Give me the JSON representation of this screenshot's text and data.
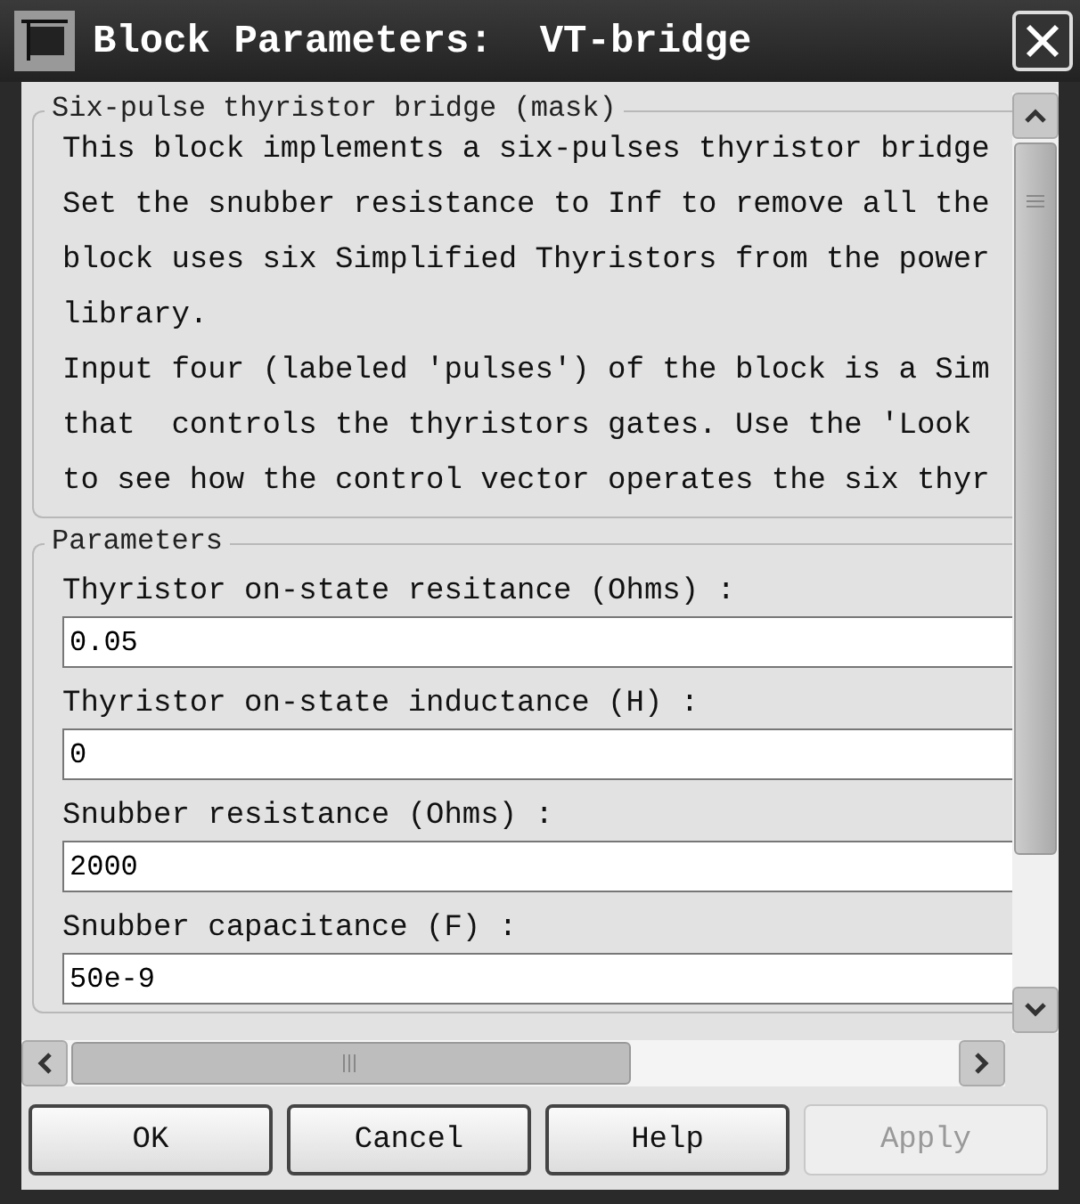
{
  "window": {
    "title": "Block Parameters:  VT-bridge"
  },
  "description": {
    "title": "Six-pulse thyristor bridge (mask)",
    "lines": [
      "This block implements a six-pulses thyristor bridge",
      "Set the snubber resistance to Inf to remove all the",
      "block uses six Simplified Thyristors from the power",
      "library.",
      "Input four (labeled 'pulses') of the block is a Sim",
      "that  controls the thyristors gates. Use the 'Look",
      "to see how the control vector operates the six thyr"
    ]
  },
  "parameters": {
    "title": "Parameters",
    "fields": [
      {
        "label": "Thyristor on-state resitance (Ohms) :",
        "value": "0.05"
      },
      {
        "label": "Thyristor on-state inductance (H) :",
        "value": "0"
      },
      {
        "label": "Snubber resistance (Ohms) :",
        "value": "2000"
      },
      {
        "label": "Snubber capacitance (F) :",
        "value": "50e-9"
      }
    ]
  },
  "buttons": [
    {
      "label": "OK",
      "disabled": false
    },
    {
      "label": "Cancel",
      "disabled": false
    },
    {
      "label": "Help",
      "disabled": false
    },
    {
      "label": "Apply",
      "disabled": true
    }
  ]
}
